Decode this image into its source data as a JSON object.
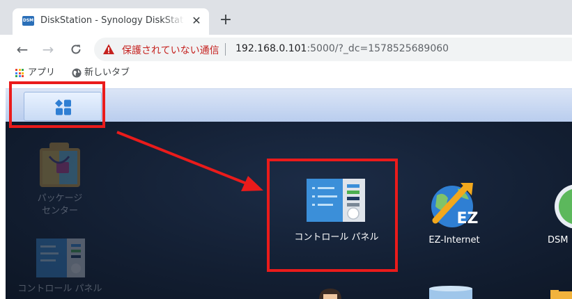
{
  "browser": {
    "tab": {
      "favicon_text": "DSM",
      "title": "DiskStation - Synology DiskStation",
      "close_glyph": "✕"
    },
    "new_tab_glyph": "+",
    "nav": {
      "back_glyph": "←",
      "forward_glyph": "→",
      "reload_glyph": "C"
    },
    "omnibox": {
      "warning_text": "保護されていない通信",
      "url_host": "192.168.0.101",
      "url_rest": ":5000/?_dc=1578525689060",
      "warning_icon": "warning-triangle-icon"
    },
    "bookmarks": [
      {
        "label": "アプリ",
        "icon": "apps-grid-icon"
      },
      {
        "label": "新しいタブ",
        "icon": "globe-icon"
      }
    ]
  },
  "dsm": {
    "main_menu_icon": "main-menu-icon",
    "desktop_apps": [
      {
        "label": "コントロール パネル",
        "icon": "control-panel-icon"
      },
      {
        "label": "EZ-Internet",
        "icon": "ez-internet-icon"
      },
      {
        "label": "DSM",
        "icon": "dsm-help-icon"
      }
    ],
    "menu_apps": [
      {
        "label_line1": "パッケージ",
        "label_line2": "センター",
        "icon": "package-center-icon"
      },
      {
        "label": "コントロール パネル",
        "icon": "control-panel-icon"
      }
    ]
  },
  "annotation": {
    "color": "#ea1b1b"
  },
  "colors": {
    "warning_red": "#c5221f",
    "desktop_bg": "#131f33",
    "dsm_blue": "#3b8fd9"
  }
}
